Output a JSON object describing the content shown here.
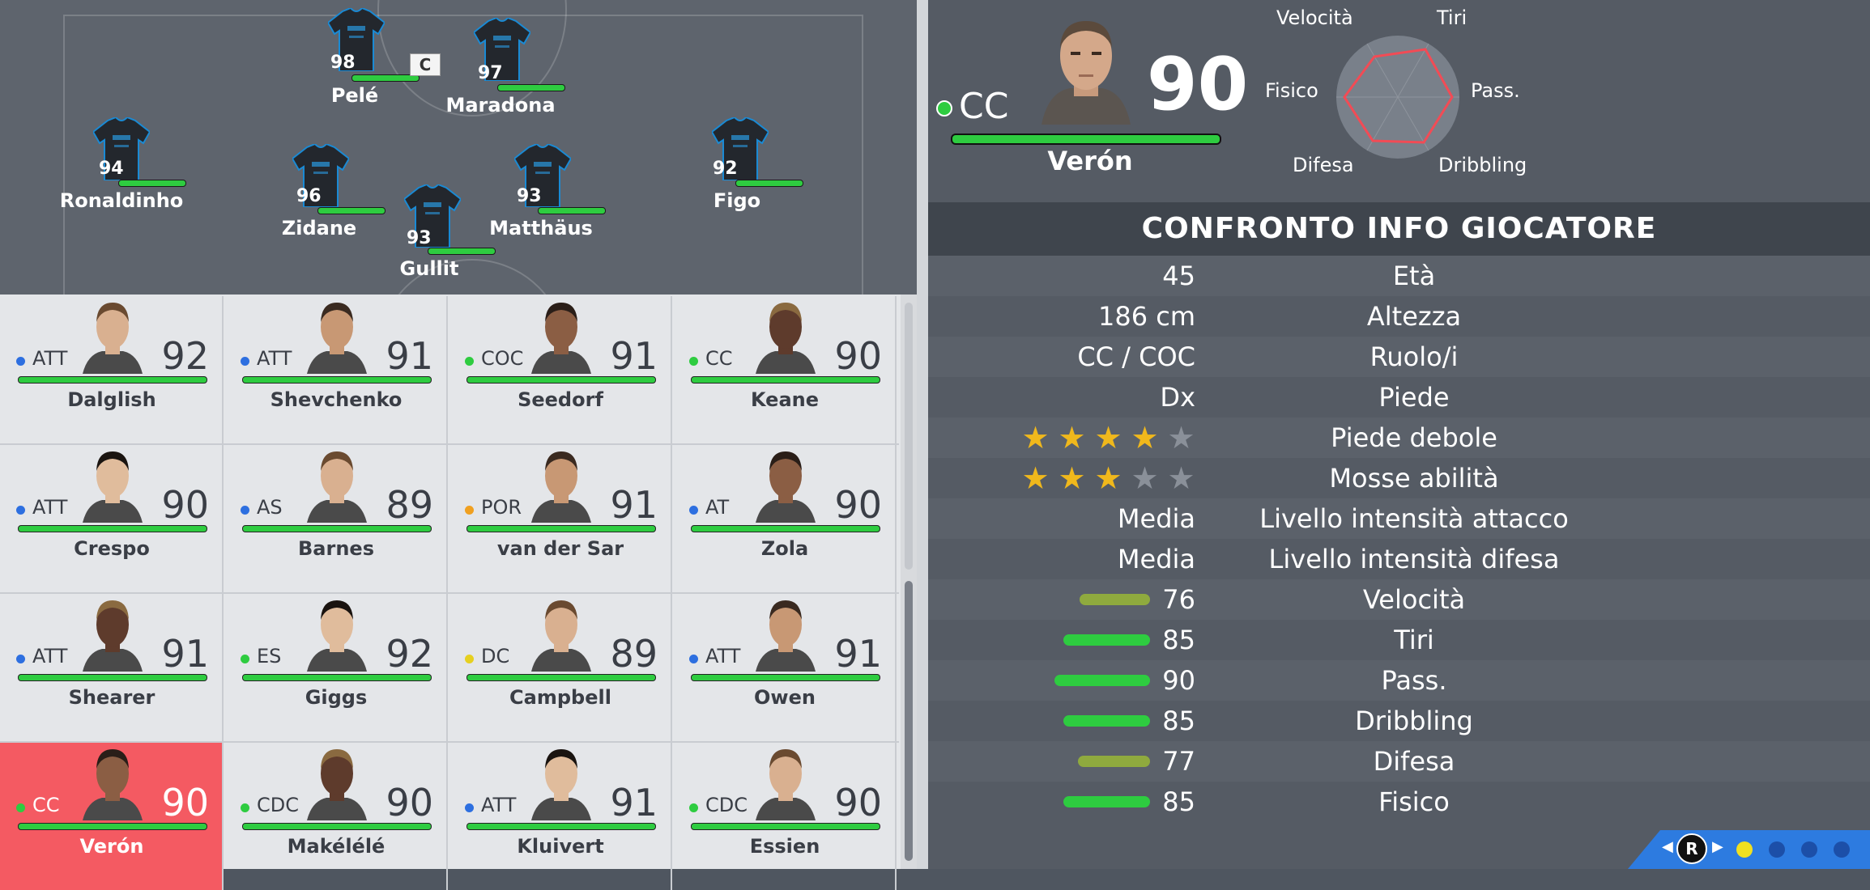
{
  "pitch": {
    "players": [
      {
        "name": "Pelé",
        "rating": "98",
        "captain": "C"
      },
      {
        "name": "Maradona",
        "rating": "97"
      },
      {
        "name": "Ronaldinho",
        "rating": "94"
      },
      {
        "name": "Zidane",
        "rating": "96"
      },
      {
        "name": "Matthäus",
        "rating": "93"
      },
      {
        "name": "Figo",
        "rating": "92"
      },
      {
        "name": "Gullit",
        "rating": "93"
      }
    ]
  },
  "squad": [
    {
      "pos": "ATT",
      "rating": "92",
      "name": "Dalglish",
      "dot": "#2d6fe0"
    },
    {
      "pos": "ATT",
      "rating": "91",
      "name": "Shevchenko",
      "dot": "#2d6fe0"
    },
    {
      "pos": "COC",
      "rating": "91",
      "name": "Seedorf",
      "dot": "#2ecc40"
    },
    {
      "pos": "CC",
      "rating": "90",
      "name": "Keane",
      "dot": "#2ecc40"
    },
    {
      "pos": "ATT",
      "rating": "90",
      "name": "Crespo",
      "dot": "#2d6fe0"
    },
    {
      "pos": "AS",
      "rating": "89",
      "name": "Barnes",
      "dot": "#2d6fe0"
    },
    {
      "pos": "POR",
      "rating": "91",
      "name": "van der Sar",
      "dot": "#f0a020"
    },
    {
      "pos": "AT",
      "rating": "90",
      "name": "Zola",
      "dot": "#2d6fe0"
    },
    {
      "pos": "ATT",
      "rating": "91",
      "name": "Shearer",
      "dot": "#2d6fe0"
    },
    {
      "pos": "ES",
      "rating": "92",
      "name": "Giggs",
      "dot": "#2ecc40"
    },
    {
      "pos": "DC",
      "rating": "89",
      "name": "Campbell",
      "dot": "#e6d020"
    },
    {
      "pos": "ATT",
      "rating": "91",
      "name": "Owen",
      "dot": "#2d6fe0"
    },
    {
      "pos": "CC",
      "rating": "90",
      "name": "Verón",
      "dot": "#2ecc40",
      "selected": true
    },
    {
      "pos": "CDC",
      "rating": "90",
      "name": "Makélélé",
      "dot": "#2ecc40"
    },
    {
      "pos": "ATT",
      "rating": "91",
      "name": "Kluivert",
      "dot": "#2d6fe0"
    },
    {
      "pos": "CDC",
      "rating": "90",
      "name": "Essien",
      "dot": "#2ecc40"
    }
  ],
  "selected_player": {
    "pos": "CC",
    "rating": "90",
    "name": "Verón",
    "radar_labels": {
      "top_left": "Velocità",
      "top_right": "Tiri",
      "left": "Fisico",
      "right": "Pass.",
      "bottom_left": "Difesa",
      "bottom_right": "Dribbling"
    }
  },
  "comparison": {
    "title": "CONFRONTO INFO GIOCATORE",
    "rows": [
      {
        "value": "45",
        "label": "Età"
      },
      {
        "value": "186 cm",
        "label": "Altezza"
      },
      {
        "value": "CC / COC",
        "label": "Ruolo/i"
      },
      {
        "value": "Dx",
        "label": "Piede"
      },
      {
        "stars": 4,
        "label": "Piede debole"
      },
      {
        "stars": 3,
        "label": "Mosse abilità"
      },
      {
        "value": "Media",
        "label": "Livello intensità attacco"
      },
      {
        "value": "Media",
        "label": "Livello intensità difesa"
      },
      {
        "value": "76",
        "label": "Velocità",
        "bar": 76,
        "bar_color": "#8faa3e"
      },
      {
        "value": "85",
        "label": "Tiri",
        "bar": 85,
        "bar_color": "#2ecc40"
      },
      {
        "value": "90",
        "label": "Pass.",
        "bar": 90,
        "bar_color": "#2ecc40"
      },
      {
        "value": "85",
        "label": "Dribbling",
        "bar": 85,
        "bar_color": "#2ecc40"
      },
      {
        "value": "77",
        "label": "Difesa",
        "bar": 77,
        "bar_color": "#8faa3e"
      },
      {
        "value": "85",
        "label": "Fisico",
        "bar": 85,
        "bar_color": "#2ecc40"
      }
    ]
  },
  "nav": {
    "button": "R",
    "active_dot_color": "#f0e020"
  }
}
